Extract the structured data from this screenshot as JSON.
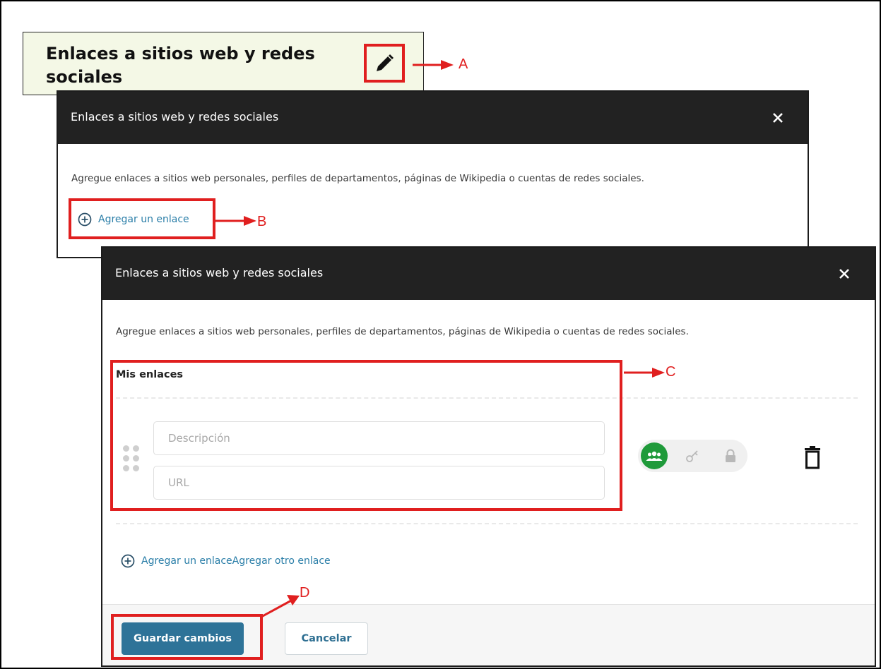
{
  "section": {
    "title": "Enlaces a sitios web y redes sociales"
  },
  "annotations": {
    "a": "A",
    "b": "B",
    "c": "C",
    "d": "D"
  },
  "modal_back": {
    "title": "Enlaces a sitios web y redes sociales",
    "close_label": "✕",
    "description": "Agregue enlaces a sitios web personales, perfiles de departamentos, páginas de Wikipedia o cuentas de redes sociales.",
    "add_link_label": "Agregar un enlace"
  },
  "modal_front": {
    "title": "Enlaces a sitios web y redes sociales",
    "close_label": "✕",
    "description": "Agregue enlaces a sitios web personales, perfiles de departamentos, páginas de Wikipedia o cuentas de redes sociales.",
    "section_label": "Mis enlaces",
    "link_item": {
      "description_placeholder": "Descripción",
      "url_placeholder": "URL",
      "visibility_options": [
        "public-icon",
        "key-icon",
        "lock-icon"
      ],
      "visibility_selected": "public-icon"
    },
    "add_link_label": "Agregar un enlaceAgregar otro enlace",
    "save_label": "Guardar cambios",
    "cancel_label": "Cancelar"
  },
  "colors": {
    "accent_red": "#e01f1f",
    "header_dark": "#222222",
    "link_blue": "#2a7ea8",
    "primary_button": "#2e7398",
    "visibility_public_green": "#1f9a3a",
    "section_bg": "#f4f8e6"
  }
}
